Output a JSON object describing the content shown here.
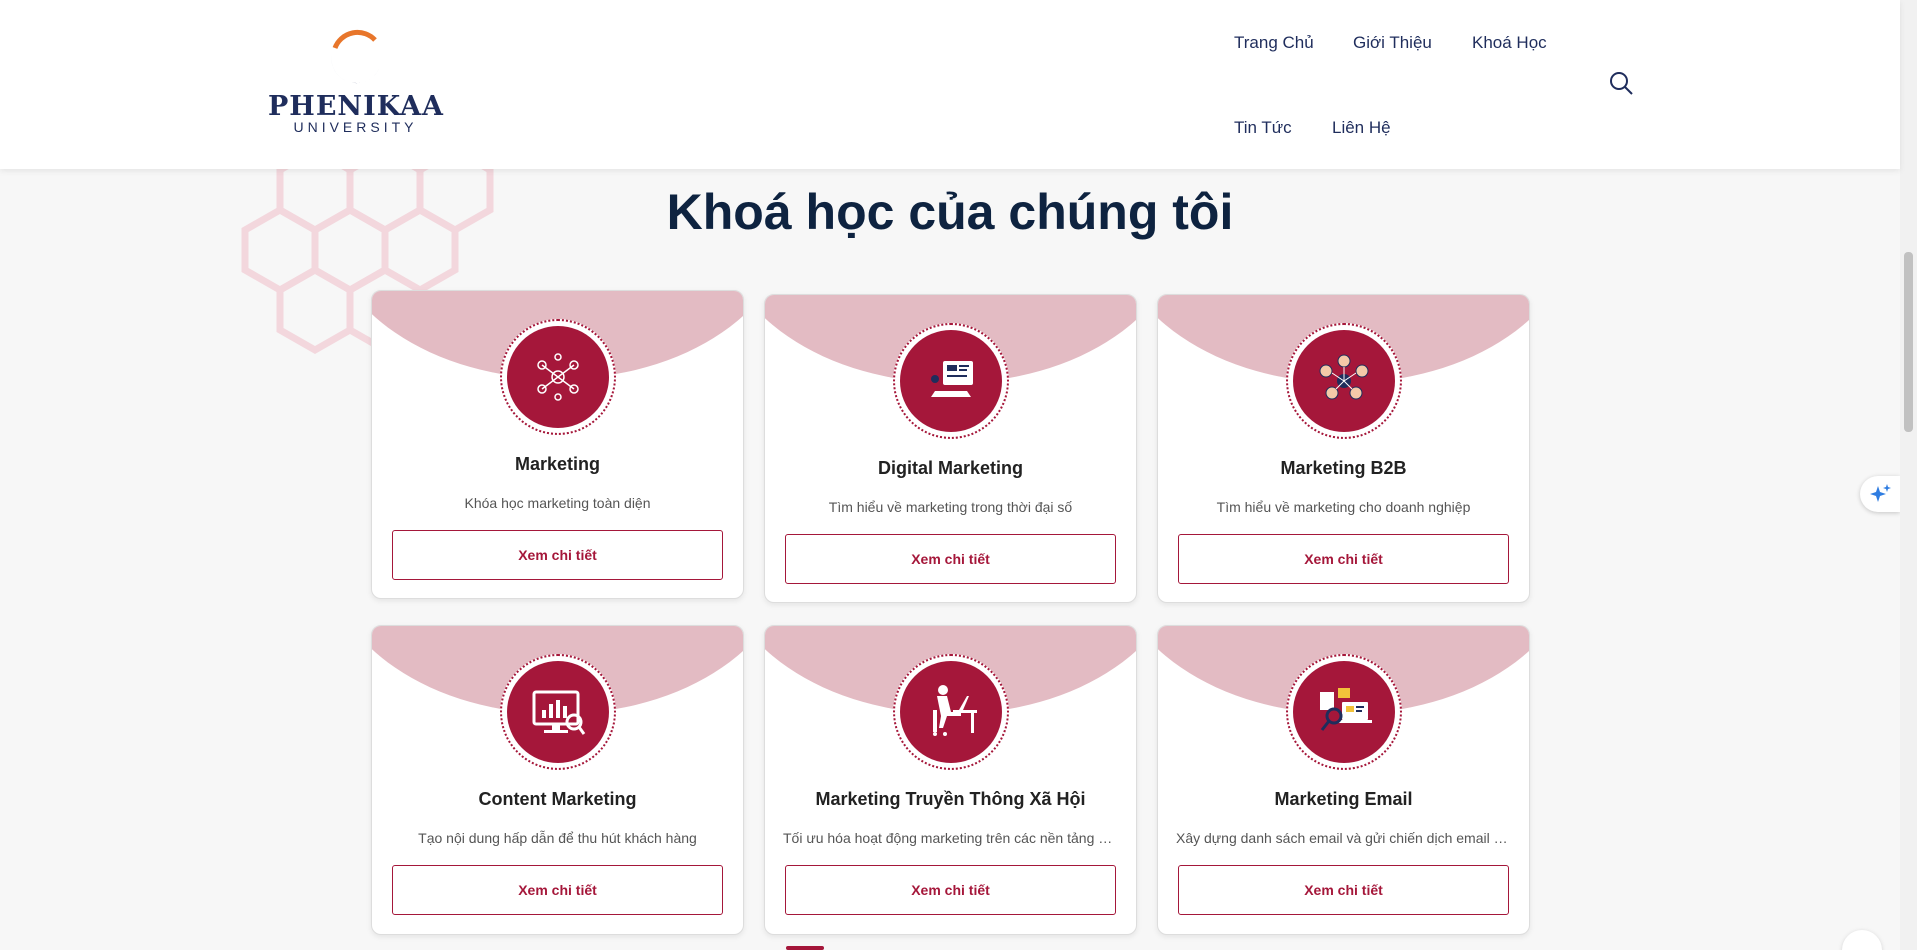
{
  "logo": {
    "brand": "PHENIKAA",
    "sub": "UNIVERSITY"
  },
  "nav": {
    "items": [
      "Trang Chủ",
      "Giới Thiệu",
      "Khoá Học",
      "Tin Tức",
      "Liên Hệ"
    ]
  },
  "icons": {
    "search": "search-icon",
    "float": "sparkle-icon"
  },
  "colors": {
    "accent": "#a5173a",
    "arc": "#e3bbc3",
    "title": "#0e2340",
    "nav": "#1f2d5c"
  },
  "section": {
    "title": "Khoá học của chúng tôi"
  },
  "courses": [
    {
      "title": "Marketing",
      "desc": "Khóa học marketing toàn diện",
      "button": "Xem chi tiết",
      "icon": "network-icon"
    },
    {
      "title": "Digital Marketing",
      "desc": "Tìm hiểu về marketing trong thời đại số",
      "button": "Xem chi tiết",
      "icon": "digital-screen-icon"
    },
    {
      "title": "Marketing B2B",
      "desc": "Tìm hiểu về marketing cho doanh nghiệp",
      "button": "Xem chi tiết",
      "icon": "business-network-icon"
    },
    {
      "title": "Content Marketing",
      "desc": "Tạo nội dung hấp dẫn để thu hút khách hàng",
      "button": "Xem chi tiết",
      "icon": "analytics-monitor-icon"
    },
    {
      "title": "Marketing Truyền Thông Xã Hội",
      "desc": "Tối ưu hóa hoạt động marketing trên các nền tảng mạng xã hội",
      "button": "Xem chi tiết",
      "icon": "person-laptop-icon"
    },
    {
      "title": "Marketing Email",
      "desc": "Xây dựng danh sách email và gửi chiến dịch email hiệu quả",
      "button": "Xem chi tiết",
      "icon": "email-campaign-icon"
    }
  ]
}
